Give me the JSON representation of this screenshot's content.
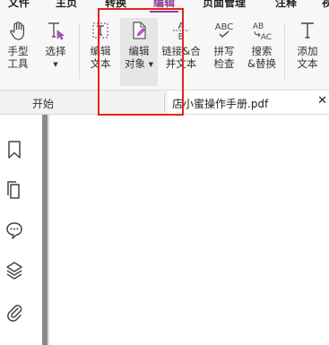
{
  "menu": [
    {
      "label": "文件",
      "active": false
    },
    {
      "label": "主页",
      "active": false
    },
    {
      "label": "转换",
      "active": false
    },
    {
      "label": "编辑",
      "active": true
    },
    {
      "label": "页面管理",
      "active": false
    },
    {
      "label": "注释",
      "active": false
    },
    {
      "label": "视",
      "active": false
    }
  ],
  "ribbon": {
    "hand": {
      "line1": "手型",
      "line2": "工具"
    },
    "select": {
      "line1": "选择"
    },
    "edit_text": {
      "line1": "编辑",
      "line2": "文本"
    },
    "edit_object": {
      "line1": "编辑",
      "line2": "对象"
    },
    "link_merge": {
      "line1": "链接&合",
      "line2": "并文本"
    },
    "spellcheck": {
      "line1": "拼写",
      "line2": "检查"
    },
    "find_replace": {
      "line1": "搜索",
      "line2": "&替换"
    },
    "add_text": {
      "line1": "添加",
      "line2": "文本"
    }
  },
  "icon_text": {
    "spell": "ABC",
    "find_top": "AB",
    "find_bottom": "AC",
    "link_top": "A",
    "link_bottom": "B"
  },
  "tabs": {
    "start": "开始",
    "file": "店小蜜操作手册.pdf",
    "close": "✕"
  },
  "colors": {
    "accent": "#8e3e9a",
    "highlight": "#e8231f"
  }
}
